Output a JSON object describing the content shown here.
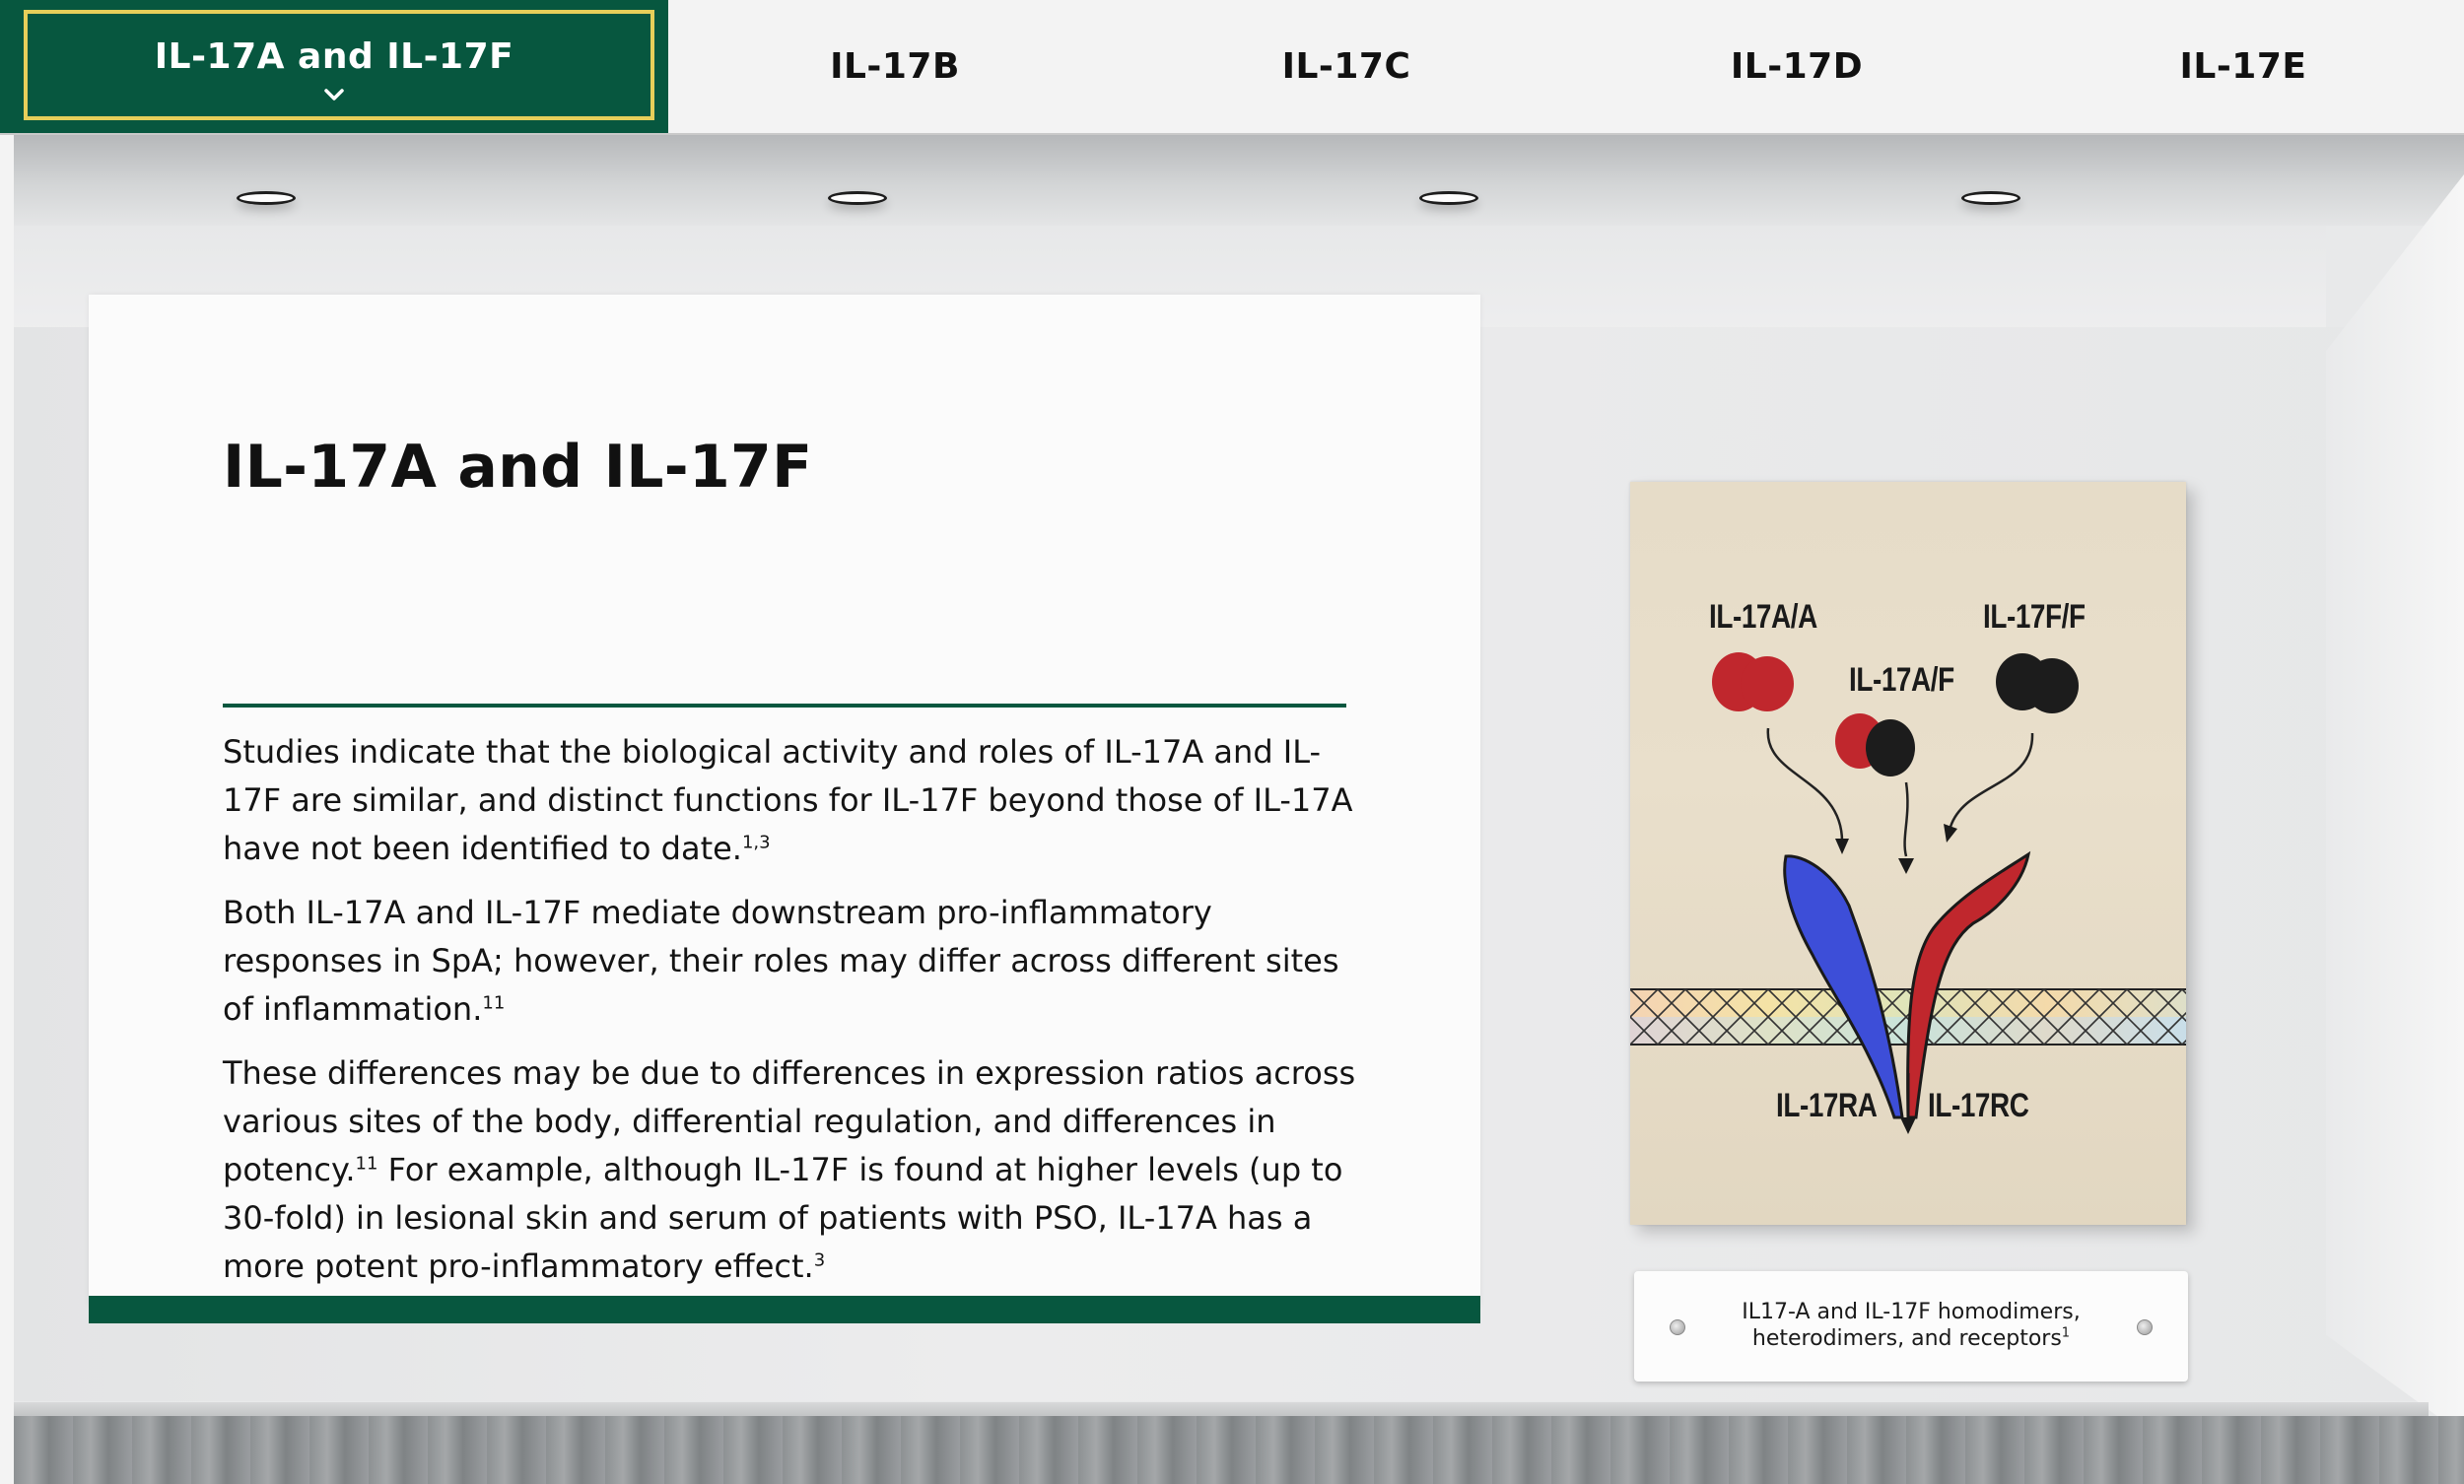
{
  "tabs": [
    {
      "label": "IL-17A and IL-17F",
      "active": true
    },
    {
      "label": "IL-17B",
      "active": false
    },
    {
      "label": "IL-17C",
      "active": false
    },
    {
      "label": "IL-17D",
      "active": false
    },
    {
      "label": "IL-17E",
      "active": false
    }
  ],
  "panel": {
    "title": "IL-17A and IL-17F",
    "paragraphs": [
      {
        "text": "Studies indicate that the biological activity and roles of IL-17A and IL-17F are similar, and distinct functions for IL-17F beyond those of IL-17A have not been identified to date.",
        "ref": "1,3"
      },
      {
        "text": "Both IL-17A and IL-17F mediate downstream pro-inflammatory responses in SpA; however, their roles may differ across different sites of inflammation.",
        "ref": "11"
      },
      {
        "text_a": "These differences may be due to differences in expression ratios across various sites of the body, differential regulation, and differences in potency.",
        "ref_a": "11",
        "text_b": " For example, although IL-17F is found at higher levels (up to 30-fold) in lesional skin and serum of patients with PSO, IL-17A has a more potent pro-inflammatory effect.",
        "ref_b": "3"
      }
    ]
  },
  "poster": {
    "labels": {
      "a_homodimer": "IL-17A/A",
      "f_homodimer": "IL-17F/F",
      "heterodimer": "IL-17A/F",
      "receptor_a": "IL-17RA",
      "receptor_c": "IL-17RC"
    },
    "colors": {
      "il17a": "#c0272d",
      "il17f": "#1c1c1c",
      "receptor_ra": "#3d4ed8",
      "receptor_rc": "#c0272d"
    }
  },
  "caption": {
    "text": "IL17-A and IL-17F homodimers, heterodimers, and receptors",
    "ref": "1"
  },
  "theme": {
    "accent": "#07573f",
    "highlight": "#e7cf5a"
  }
}
